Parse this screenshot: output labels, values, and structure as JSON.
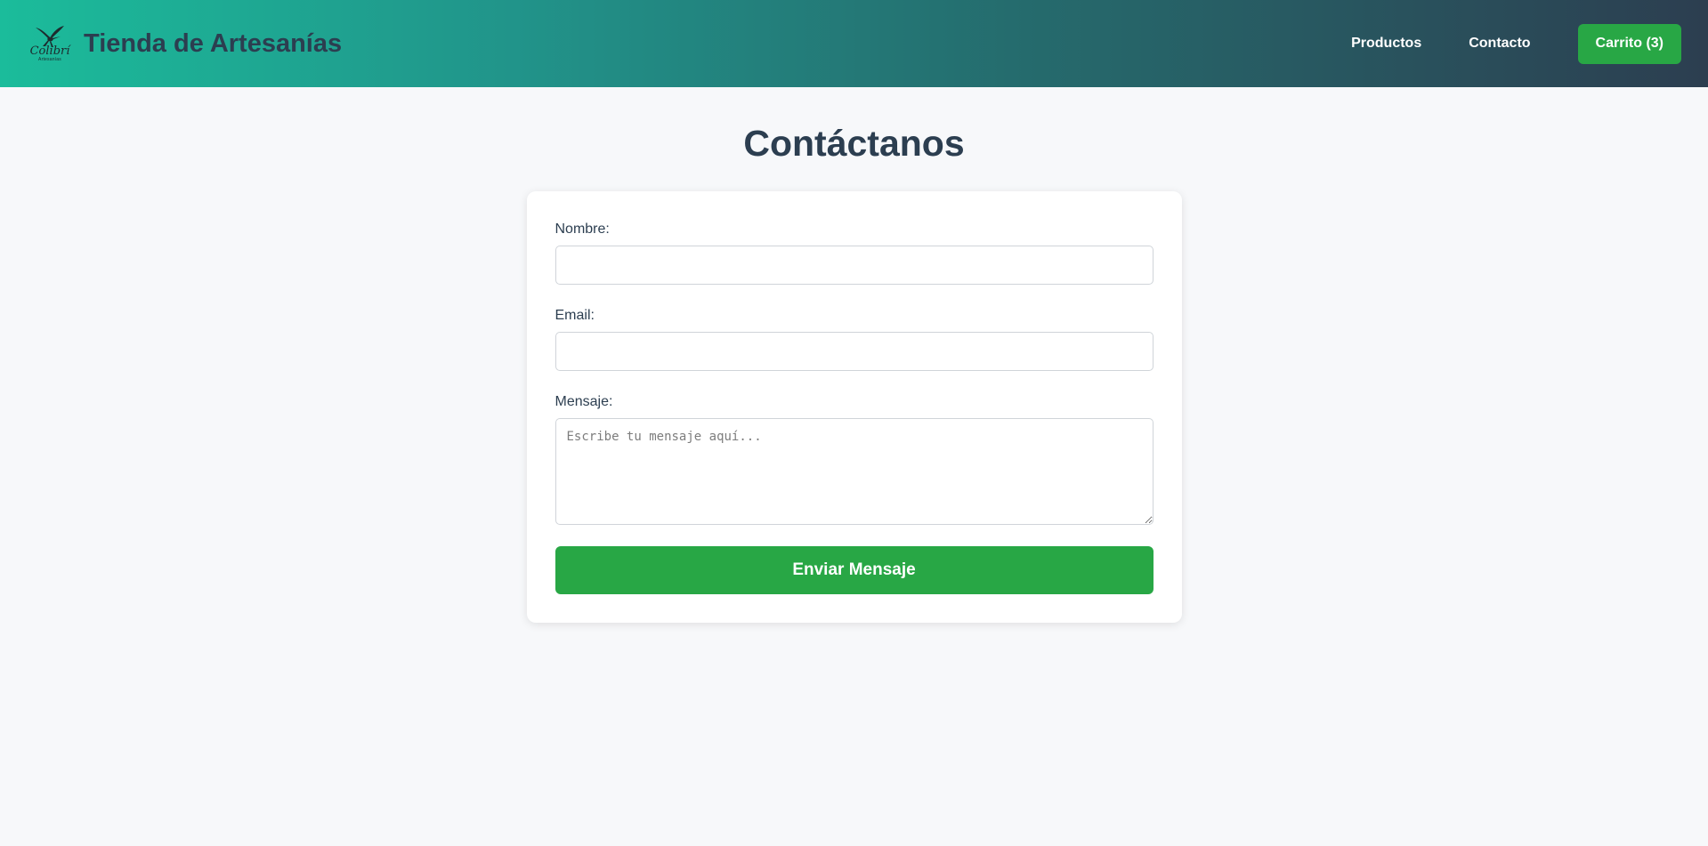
{
  "header": {
    "logo": {
      "icon": "hummingbird-icon",
      "text": "Colibrí",
      "subtext": "Artesanías"
    },
    "title": "Tienda de Artesanías",
    "nav": {
      "products_label": "Productos",
      "contact_label": "Contacto",
      "cart_label": "Carrito (3)"
    }
  },
  "main": {
    "title": "Contáctanos",
    "form": {
      "name_label": "Nombre:",
      "name_value": "",
      "email_label": "Email:",
      "email_value": "",
      "message_label": "Mensaje:",
      "message_placeholder": "Escribe tu mensaje aquí...",
      "submit_label": "Enviar Mensaje"
    }
  },
  "colors": {
    "header_gradient_start": "#1bbc9b",
    "header_gradient_end": "#2c3e50",
    "accent_green": "#28a745",
    "title_color": "#2c3e50",
    "background": "#f7f8fa"
  }
}
